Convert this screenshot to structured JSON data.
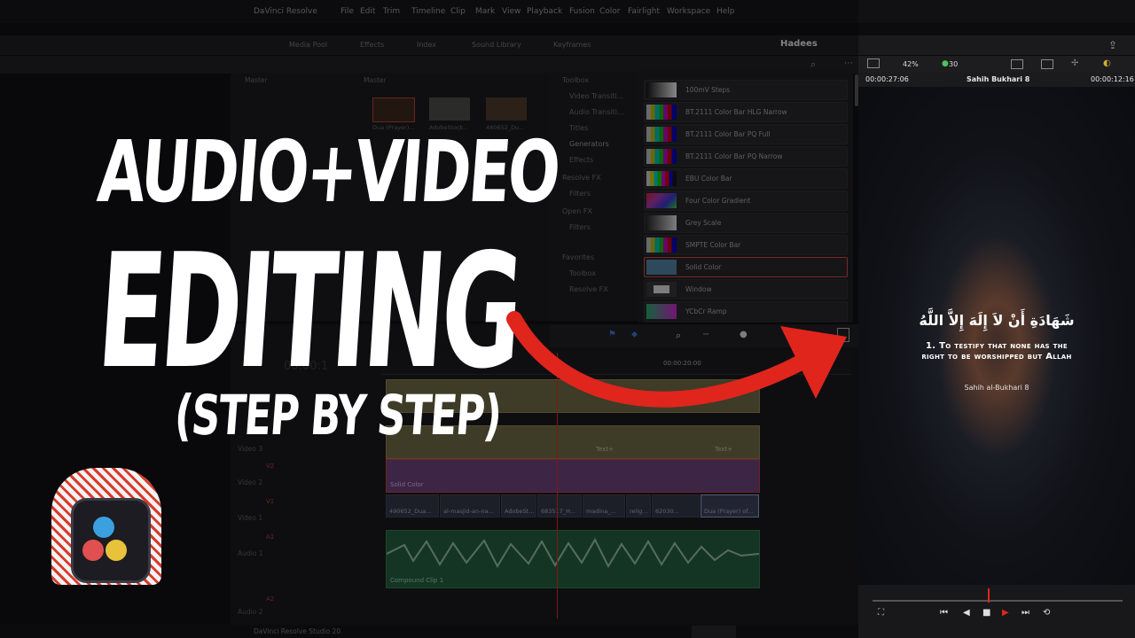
{
  "menubar": {
    "app_menu": "DaVinci Resolve",
    "items": [
      "File",
      "Edit",
      "Trim",
      "Timeline",
      "Clip",
      "Mark",
      "View",
      "Playback",
      "Fusion",
      "Color",
      "Fairlight",
      "Workspace",
      "Help"
    ]
  },
  "toolbar": {
    "media_pool": "Media Pool",
    "effects": "Effects",
    "index": "Index",
    "sound_library": "Sound Library",
    "keyframes": "Keyframes",
    "project_title": "Hadees",
    "zoom": "42%",
    "fps": "30"
  },
  "media": {
    "folder_left": "Master",
    "folder_right": "Master",
    "thumbs": [
      "Dua (Prayer)...",
      "AdobeStock...",
      "480652_Du..."
    ]
  },
  "effects_tree": [
    {
      "label": "Toolbox",
      "highlight": false
    },
    {
      "label": "Video Transiti...",
      "highlight": false
    },
    {
      "label": "Audio Transiti...",
      "highlight": false
    },
    {
      "label": "Titles",
      "highlight": false
    },
    {
      "label": "Generators",
      "highlight": true
    },
    {
      "label": "Effects",
      "highlight": false
    },
    {
      "label": "Resolve FX",
      "highlight": false
    },
    {
      "label": "Filters",
      "highlight": false
    },
    {
      "label": "Open FX",
      "highlight": false
    },
    {
      "label": "Filters",
      "highlight": false
    },
    {
      "label": "Favorites",
      "highlight": false
    },
    {
      "label": "Toolbox",
      "highlight": false
    },
    {
      "label": "Resolve FX",
      "highlight": false
    }
  ],
  "generators": [
    {
      "label": "100mV Steps",
      "selected": false,
      "thumb": "steps"
    },
    {
      "label": "BT.2111 Color Bar HLG Narrow",
      "selected": false,
      "thumb": "bars"
    },
    {
      "label": "BT.2111 Color Bar PQ Full",
      "selected": false,
      "thumb": "bars"
    },
    {
      "label": "BT.2111 Color Bar PQ Narrow",
      "selected": false,
      "thumb": "bars"
    },
    {
      "label": "EBU Color Bar",
      "selected": false,
      "thumb": "ebu"
    },
    {
      "label": "Four Color Gradient",
      "selected": false,
      "thumb": "gradient"
    },
    {
      "label": "Grey Scale",
      "selected": false,
      "thumb": "grey"
    },
    {
      "label": "SMPTE Color Bar",
      "selected": false,
      "thumb": "smpte"
    },
    {
      "label": "Solid Color",
      "selected": true,
      "thumb": "solid"
    },
    {
      "label": "Window",
      "selected": false,
      "thumb": "window"
    },
    {
      "label": "YCbCr Ramp",
      "selected": false,
      "thumb": "ramp"
    }
  ],
  "viewer": {
    "timecode_left": "00:00:27:06",
    "clip_name": "Sahih Bukhari 8",
    "timecode_right": "00:00:12:16",
    "arabic": "شَهَادَةِ أَنْ لاَ إِلَهَ إِلاَّ اللَّهُ",
    "caption_line1": "1. To testify that none has the",
    "caption_line2": "right to be worshipped but Allah",
    "source": "Sahih al-Bukhari 8"
  },
  "timeline": {
    "timecode": "00:00:1",
    "ruler_mark": "00:00:20:00",
    "tracks": [
      {
        "tag": "",
        "name": "Video 3"
      },
      {
        "tag": "V2",
        "name": "Video 2"
      },
      {
        "tag": "V1",
        "name": "Video 1"
      },
      {
        "tag": "A1",
        "name": "Audio 1"
      },
      {
        "tag": "A2",
        "name": "Audio 2"
      }
    ],
    "text_clips": [
      "Text+",
      "Text+",
      "Text+",
      "Text+"
    ],
    "solid_clip": "Solid Color",
    "video_clips": [
      "490652_Dua...",
      "al-masjid-an-na...",
      "AdobeSt...",
      "683517_H...",
      "madina_...",
      "relig...",
      "62030...",
      "Dua (Prayer) of..."
    ],
    "audio_clip": "Compound Clip 1"
  },
  "bottombar": {
    "app_version": "DaVinci Resolve Studio 20"
  },
  "overlay": {
    "line1": "AUDIO+VIDEO",
    "line2": "EDITING",
    "line3": "(STEP BY STEP)"
  },
  "colors": {
    "accent_red": "#e0251d",
    "selection": "#d24a3a",
    "audio": "#2f7a4e",
    "text_clip": "#6c6640",
    "solid_clip": "#6a3f78"
  }
}
